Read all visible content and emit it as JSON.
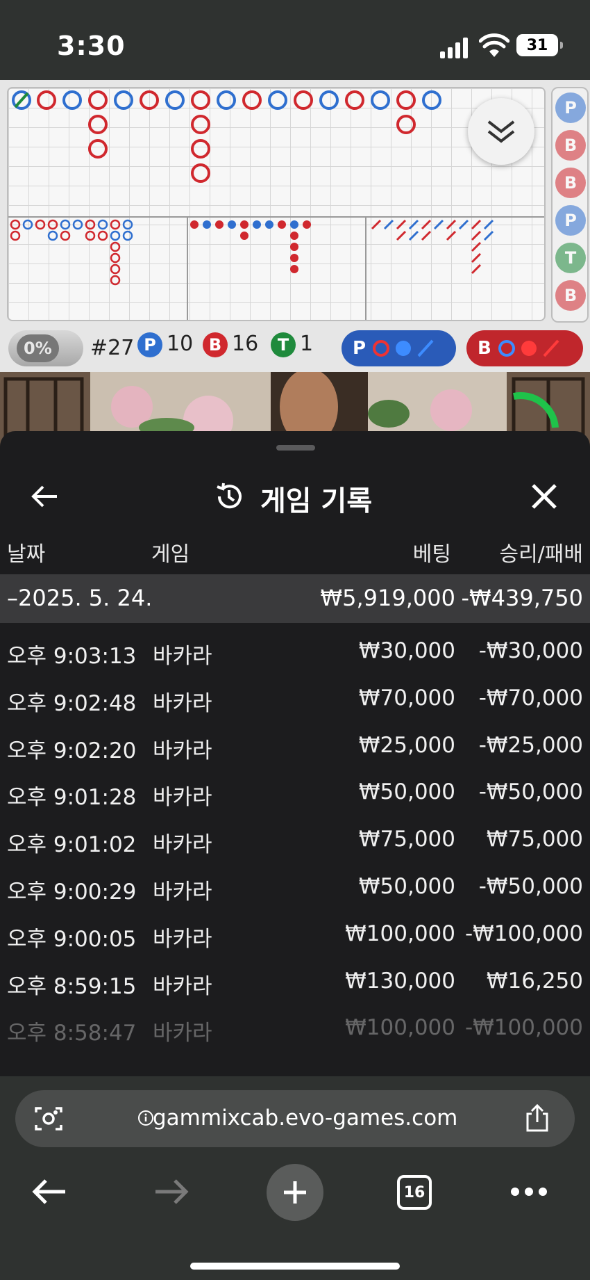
{
  "status": {
    "time": "3:30",
    "battery": "31"
  },
  "scoreboard": {
    "percent": "0%",
    "round": "#27",
    "player_label": "P",
    "player_count": "10",
    "banker_label": "B",
    "banker_count": "16",
    "tie_label": "T",
    "tie_count": "1",
    "predict_player": "P",
    "predict_banker": "B",
    "side_items": [
      "P",
      "B",
      "B",
      "P",
      "T",
      "B"
    ],
    "colors": {
      "player": "#2f6fcf",
      "banker": "#d0282e",
      "tie": "#1f8a3c"
    }
  },
  "history": {
    "title": "게임 기록",
    "columns": {
      "date": "날짜",
      "game": "게임",
      "bet": "베팅",
      "winloss": "승리/패배"
    },
    "date_row": {
      "date": "–2025. 5. 24.",
      "bet": "₩5,919,000",
      "winloss": "-₩439,750"
    },
    "rows": [
      {
        "time": "오후 9:03:13",
        "game": "바카라",
        "bet": "₩30,000",
        "winloss": "-₩30,000"
      },
      {
        "time": "오후 9:02:48",
        "game": "바카라",
        "bet": "₩70,000",
        "winloss": "-₩70,000"
      },
      {
        "time": "오후 9:02:20",
        "game": "바카라",
        "bet": "₩25,000",
        "winloss": "-₩25,000"
      },
      {
        "time": "오후 9:01:28",
        "game": "바카라",
        "bet": "₩50,000",
        "winloss": "-₩50,000"
      },
      {
        "time": "오후 9:01:02",
        "game": "바카라",
        "bet": "₩75,000",
        "winloss": "₩75,000"
      },
      {
        "time": "오후 9:00:29",
        "game": "바카라",
        "bet": "₩50,000",
        "winloss": "-₩50,000"
      },
      {
        "time": "오후 9:00:05",
        "game": "바카라",
        "bet": "₩100,000",
        "winloss": "-₩100,000"
      },
      {
        "time": "오후 8:59:15",
        "game": "바카라",
        "bet": "₩130,000",
        "winloss": "₩16,250"
      },
      {
        "time": "오후 8:58:47",
        "game": "바카라",
        "bet": "₩100,000",
        "winloss": "-₩100,000"
      }
    ]
  },
  "browser": {
    "url": "gammixcab.evo-games.com",
    "tab_count": "16"
  }
}
